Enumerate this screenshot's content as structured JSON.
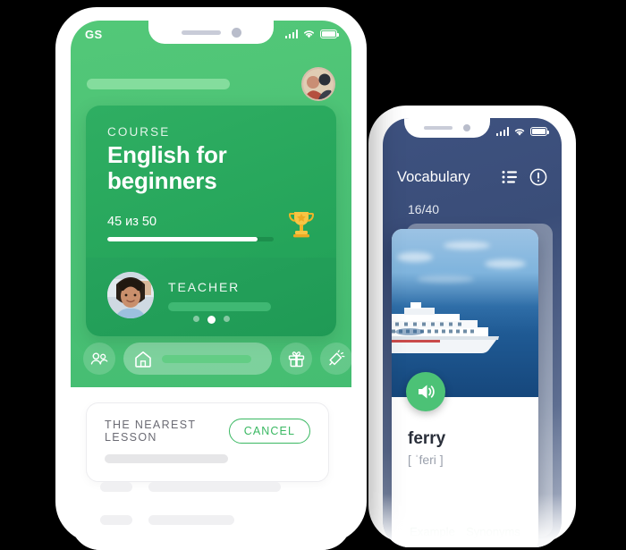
{
  "background_color": "#000000",
  "phone1": {
    "status_bar": {
      "brand": "GS",
      "icons": [
        "signal-icon",
        "wifi-icon",
        "battery-icon"
      ]
    },
    "header": {
      "search_placeholder_bar": "",
      "avatar": "user-avatar"
    },
    "course_card": {
      "kicker": "COURSE",
      "title": "English for beginners",
      "progress_label": "45 из 50",
      "progress_percent": 90,
      "trophy_icon": "trophy-icon",
      "teacher": {
        "label": "TEACHER",
        "avatar": "teacher-avatar",
        "name_placeholder": ""
      }
    },
    "pagination": {
      "count": 3,
      "active_index": 1
    },
    "tab_bar": {
      "items": [
        {
          "icon": "people-icon",
          "active": false
        },
        {
          "icon": "home-icon",
          "active": true
        },
        {
          "icon": "gift-icon",
          "active": false
        },
        {
          "icon": "megaphone-icon",
          "active": false
        }
      ]
    },
    "lesson_card": {
      "title": "THE NEAREST LESSON",
      "cancel_label": "CANCEL",
      "accent_color": "#3ab862"
    },
    "skeleton_rows": [
      {
        "short_width": 36,
        "long_width": 148
      },
      {
        "short_width": 36,
        "long_width": 96
      }
    ]
  },
  "phone2": {
    "status_bar": {
      "icons": [
        "signal-icon",
        "wifi-icon",
        "battery-icon"
      ]
    },
    "header": {
      "title": "Vocabulary",
      "list_icon": "list-icon",
      "info_icon": "exclamation-circle-icon"
    },
    "counter": "16/40",
    "card": {
      "image": "ferry-ship-photo",
      "audio_button": "speaker-icon",
      "word": "ferry",
      "phonetic": "[ ˈferi ]"
    },
    "tabs": [
      {
        "label": "Example"
      },
      {
        "label": "Synonyms"
      }
    ]
  },
  "colors": {
    "green_primary": "#4cc276",
    "green_dark": "#23a359",
    "navy": "#3e5280",
    "accent_green": "#3ab862"
  }
}
